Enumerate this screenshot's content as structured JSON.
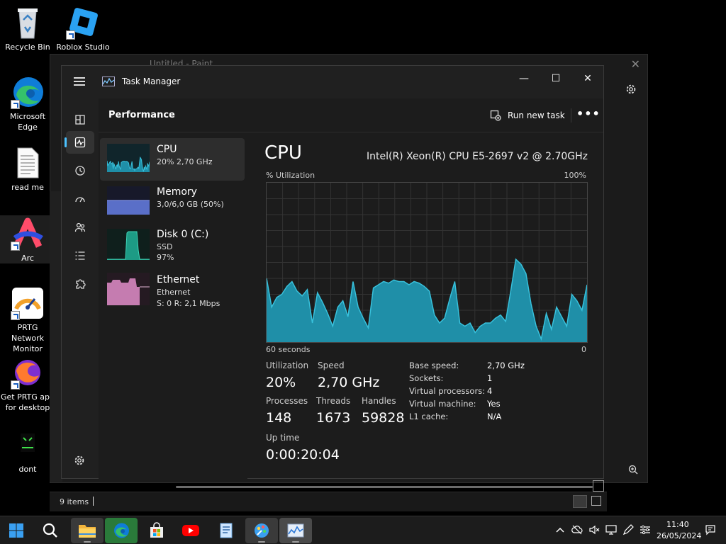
{
  "desktop": {
    "icons": [
      {
        "label": "Recycle Bin"
      },
      {
        "label": "Roblox Studio"
      },
      {
        "label": "Microsoft Edge"
      },
      {
        "label": "read me"
      },
      {
        "label": "Arc"
      },
      {
        "label": "PRTG Network Monitor"
      },
      {
        "label": "Get PRTG app for desktop"
      },
      {
        "label": "dont"
      }
    ]
  },
  "background_window": {
    "title": "Untitled - Paint",
    "items_count": "9 items"
  },
  "task_manager": {
    "title": "Task Manager",
    "page_title": "Performance",
    "run_new_task": "Run new task",
    "more": "•••",
    "resources": [
      {
        "name": "CPU",
        "line1": "20% 2,70 GHz",
        "line2": ""
      },
      {
        "name": "Memory",
        "line1": "3,0/6,0 GB (50%)",
        "line2": ""
      },
      {
        "name": "Disk 0 (C:)",
        "line1": "SSD",
        "line2": "97%"
      },
      {
        "name": "Ethernet",
        "line1": "Ethernet",
        "line2": "S: 0 R: 2,1 Mbps"
      }
    ],
    "detail": {
      "title": "CPU",
      "model": "Intel(R) Xeon(R) CPU E5-2697 v2 @ 2.70GHz",
      "util_label": "% Utilization",
      "util_max": "100%",
      "time_label": "60 seconds",
      "time_min": "0",
      "stats": {
        "utilization_label": "Utilization",
        "utilization": "20%",
        "speed_label": "Speed",
        "speed": "2,70 GHz",
        "processes_label": "Processes",
        "processes": "148",
        "threads_label": "Threads",
        "threads": "1673",
        "handles_label": "Handles",
        "handles": "59828",
        "uptime_label": "Up time",
        "uptime": "0:00:20:04"
      },
      "specs": [
        {
          "key": "Base speed:",
          "value": "2,70 GHz"
        },
        {
          "key": "Sockets:",
          "value": "1"
        },
        {
          "key": "Virtual processors:",
          "value": "4"
        },
        {
          "key": "Virtual machine:",
          "value": "Yes"
        },
        {
          "key": "L1 cache:",
          "value": "N/A"
        }
      ]
    },
    "cpu_history_percent": [
      40,
      22,
      28,
      30,
      35,
      38,
      32,
      29,
      33,
      12,
      31,
      25,
      18,
      10,
      22,
      26,
      16,
      38,
      22,
      15,
      9,
      34,
      36,
      38,
      37,
      39,
      38,
      38,
      36,
      38,
      37,
      35,
      32,
      17,
      12,
      15,
      27,
      38,
      12,
      10,
      12,
      6,
      10,
      12,
      12,
      15,
      17,
      13,
      32,
      52,
      49,
      43,
      24,
      10,
      2,
      18,
      8,
      22,
      16,
      10,
      30,
      26,
      20,
      36
    ],
    "colors": {
      "accent": "#4cc2ff",
      "cpu_fill": "#1f8fa8",
      "cpu_line": "#38c1dc",
      "memory_fill": "#5a6fc8",
      "disk_fill": "#1d9b85",
      "net_fill": "#c57cb0"
    }
  },
  "taskbar": {
    "apps": [
      "start-icon",
      "search-icon",
      "file-explorer-icon",
      "edge-icon",
      "store-icon",
      "youtube-icon",
      "notepad-icon",
      "paint-icon",
      "task-manager-icon"
    ],
    "time": "11:40",
    "date": "26/05/2024"
  }
}
